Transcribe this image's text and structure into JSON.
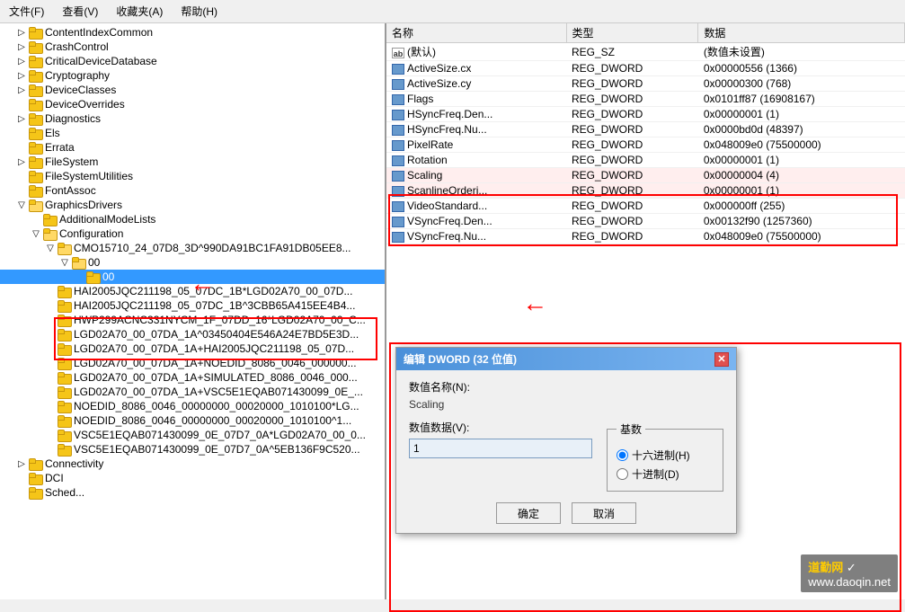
{
  "menu": {
    "items": [
      "文件(F)",
      "查看(V)",
      "收藏夹(A)",
      "帮助(H)"
    ]
  },
  "left_tree": {
    "items": [
      {
        "label": "ContentIndexCommon",
        "indent": 1,
        "has_toggle": true,
        "toggle": "▷",
        "level": 0
      },
      {
        "label": "CrashControl",
        "indent": 1,
        "has_toggle": true,
        "toggle": "▷",
        "level": 0
      },
      {
        "label": "CriticalDeviceDatabase",
        "indent": 1,
        "has_toggle": true,
        "toggle": "▷",
        "level": 0
      },
      {
        "label": "Cryptography",
        "indent": 1,
        "has_toggle": true,
        "toggle": "▷",
        "level": 0
      },
      {
        "label": "DeviceClasses",
        "indent": 1,
        "has_toggle": true,
        "toggle": "▷",
        "level": 0
      },
      {
        "label": "DeviceOverrides",
        "indent": 1,
        "has_toggle": false,
        "toggle": "",
        "level": 0
      },
      {
        "label": "Diagnostics",
        "indent": 1,
        "has_toggle": true,
        "toggle": "▷",
        "level": 0
      },
      {
        "label": "Els",
        "indent": 1,
        "has_toggle": false,
        "toggle": "",
        "level": 0
      },
      {
        "label": "Errata",
        "indent": 1,
        "has_toggle": false,
        "toggle": "",
        "level": 0
      },
      {
        "label": "FileSystem",
        "indent": 1,
        "has_toggle": true,
        "toggle": "▷",
        "level": 0
      },
      {
        "label": "FileSystemUtilities",
        "indent": 1,
        "has_toggle": false,
        "toggle": "",
        "level": 0
      },
      {
        "label": "FontAssoc",
        "indent": 1,
        "has_toggle": false,
        "toggle": "",
        "level": 0
      },
      {
        "label": "GraphicsDrivers",
        "indent": 1,
        "has_toggle": true,
        "toggle": "▽",
        "level": 0,
        "expanded": true
      },
      {
        "label": "AdditionalModeLists",
        "indent": 2,
        "has_toggle": false,
        "toggle": "",
        "level": 1
      },
      {
        "label": "Configuration",
        "indent": 2,
        "has_toggle": true,
        "toggle": "▽",
        "level": 1,
        "expanded": true
      },
      {
        "label": "CMO15710_24_07D8_3D^990DA91BC1FA91DB05EE8...",
        "indent": 3,
        "has_toggle": true,
        "toggle": "▽",
        "level": 2,
        "expanded": true
      },
      {
        "label": "00",
        "indent": 4,
        "has_toggle": true,
        "toggle": "▽",
        "level": 3,
        "expanded": true,
        "selected": false
      },
      {
        "label": "00",
        "indent": 5,
        "has_toggle": false,
        "toggle": "",
        "level": 4,
        "selected": true
      },
      {
        "label": "HAI2005JQC211198_05_07DC_1B*LGD02A70_00_07D...",
        "indent": 3,
        "has_toggle": false,
        "toggle": "",
        "level": 2
      },
      {
        "label": "HAI2005JQC211198_05_07DC_1B^3CBB65A415EE4B4...",
        "indent": 3,
        "has_toggle": false,
        "toggle": "",
        "level": 2
      },
      {
        "label": "HWP299ACNC331NYCM_1F_07DD_16*LGD02A70_00_C...",
        "indent": 3,
        "has_toggle": false,
        "toggle": "",
        "level": 2
      },
      {
        "label": "LGD02A70_00_07DA_1A^03450404E546A24E7BD5E3D...",
        "indent": 3,
        "has_toggle": false,
        "toggle": "",
        "level": 2
      },
      {
        "label": "LGD02A70_00_07DA_1A+HAI2005JQC211198_05_07D...",
        "indent": 3,
        "has_toggle": false,
        "toggle": "",
        "level": 2
      },
      {
        "label": "LGD02A70_00_07DA_1A+NOEDID_8086_0046_000000...",
        "indent": 3,
        "has_toggle": false,
        "toggle": "",
        "level": 2
      },
      {
        "label": "LGD02A70_00_07DA_1A+SIMULATED_8086_0046_000...",
        "indent": 3,
        "has_toggle": false,
        "toggle": "",
        "level": 2
      },
      {
        "label": "LGD02A70_00_07DA_1A+VSC5E1EQAB071430099_0E_...",
        "indent": 3,
        "has_toggle": false,
        "toggle": "",
        "level": 2
      },
      {
        "label": "NOEDID_8086_0046_00000000_00020000_1010100*LG...",
        "indent": 3,
        "has_toggle": false,
        "toggle": "",
        "level": 2
      },
      {
        "label": "NOEDID_8086_0046_00000000_00020000_1010100^1...",
        "indent": 3,
        "has_toggle": false,
        "toggle": "",
        "level": 2
      },
      {
        "label": "VSC5E1EQAB071430099_0E_07D7_0A*LGD02A70_00_0...",
        "indent": 3,
        "has_toggle": false,
        "toggle": "",
        "level": 2
      },
      {
        "label": "VSC5E1EQAB071430099_0E_07D7_0A^5EB136F9C520...",
        "indent": 3,
        "has_toggle": false,
        "toggle": "",
        "level": 2
      },
      {
        "label": "Connectivity",
        "indent": 1,
        "has_toggle": true,
        "toggle": "▷",
        "level": 0
      },
      {
        "label": "DCI",
        "indent": 1,
        "has_toggle": false,
        "toggle": "",
        "level": 0
      },
      {
        "label": "Sched...",
        "indent": 1,
        "has_toggle": false,
        "toggle": "",
        "level": 0
      }
    ]
  },
  "right_pane": {
    "columns": [
      "名称",
      "类型",
      "数据"
    ],
    "rows": [
      {
        "name": "(默认)",
        "type": "REG_SZ",
        "data": "(数值未设置)",
        "icon": "ab"
      },
      {
        "name": "ActiveSize.cx",
        "type": "REG_DWORD",
        "data": "0x00000556 (1366)",
        "icon": "dword"
      },
      {
        "name": "ActiveSize.cy",
        "type": "REG_DWORD",
        "data": "0x00000300 (768)",
        "icon": "dword"
      },
      {
        "name": "Flags",
        "type": "REG_DWORD",
        "data": "0x0101ff87 (16908167)",
        "icon": "dword"
      },
      {
        "name": "HSyncFreq.Den...",
        "type": "REG_DWORD",
        "data": "0x00000001 (1)",
        "icon": "dword"
      },
      {
        "name": "HSyncFreq.Nu...",
        "type": "REG_DWORD",
        "data": "0x0000bd0d (48397)",
        "icon": "dword"
      },
      {
        "name": "PixelRate",
        "type": "REG_DWORD",
        "data": "0x048009e0 (75500000)",
        "icon": "dword"
      },
      {
        "name": "Rotation",
        "type": "REG_DWORD",
        "data": "0x00000001 (1)",
        "icon": "dword",
        "highlight": false
      },
      {
        "name": "Scaling",
        "type": "REG_DWORD",
        "data": "0x00000004 (4)",
        "icon": "dword",
        "highlight": true
      },
      {
        "name": "ScanlineOrderi...",
        "type": "REG_DWORD",
        "data": "0x00000001 (1)",
        "icon": "dword",
        "highlight": true
      },
      {
        "name": "VideoStandard...",
        "type": "REG_DWORD",
        "data": "0x000000ff (255)",
        "icon": "dword"
      },
      {
        "name": "VSyncFreq.Den...",
        "type": "REG_DWORD",
        "data": "0x00132f90 (1257360)",
        "icon": "dword"
      },
      {
        "name": "VSyncFreq.Nu...",
        "type": "REG_DWORD",
        "data": "0x048009e0 (75500000)",
        "icon": "dword"
      }
    ]
  },
  "dialog": {
    "title": "编辑 DWORD (32 位值)",
    "value_name_label": "数值名称(N):",
    "value_name": "Scaling",
    "value_data_label": "数值数据(V):",
    "value_data": "1",
    "base_label": "基数",
    "hex_label": "十六进制(H)",
    "dec_label": "十进制(D)",
    "ok_label": "确定",
    "cancel_label": "取消"
  },
  "watermark": {
    "text_zh": "道勤网",
    "text_en": "www.daoqin.net",
    "symbol": "✓"
  }
}
